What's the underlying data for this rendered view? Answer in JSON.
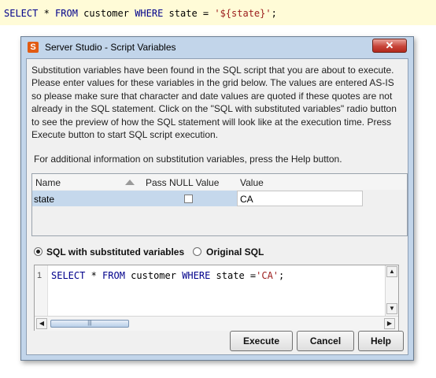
{
  "editor": {
    "kw_select": "SELECT",
    "star": " * ",
    "kw_from": "FROM",
    "table": " customer ",
    "kw_where": "WHERE",
    "condition": " state = ",
    "literal": "'${state}'",
    "end": ";"
  },
  "dialog": {
    "title": "Server Studio - Script Variables",
    "close_glyph": "✕",
    "app_icon_glyph": "S",
    "instructions": [
      "Substitution variables have been found in the SQL script that you are about to execute.",
      "Please enter values for these variables in the grid below. The values are entered AS-IS",
      "so please make sure that character and date values are quoted if these quotes are not",
      "already in the SQL statement.  Click on the \"SQL with substituted variables\" radio button",
      "to see the preview of how the SQL statement will look like at the execution time. Press",
      "Execute button to start SQL script execution."
    ],
    "help_note": "For additional information on substitution variables, press the Help button.",
    "grid": {
      "headers": {
        "name": "Name",
        "pass_null": "Pass NULL Value",
        "value": "Value"
      },
      "rows": [
        {
          "name": "state",
          "pass_null": false,
          "value": "CA"
        }
      ]
    },
    "radios": {
      "substituted": {
        "label": "SQL with substituted variables",
        "checked": true
      },
      "original": {
        "label": "Original SQL",
        "checked": false
      }
    },
    "preview": {
      "line_number": "1",
      "kw_select": "SELECT",
      "star": " * ",
      "kw_from": "FROM",
      "table": " customer ",
      "kw_where": "WHERE",
      "condition": " state =",
      "literal": "'CA'",
      "end": ";"
    },
    "buttons": {
      "execute": "Execute",
      "cancel": "Cancel",
      "help": "Help"
    }
  }
}
